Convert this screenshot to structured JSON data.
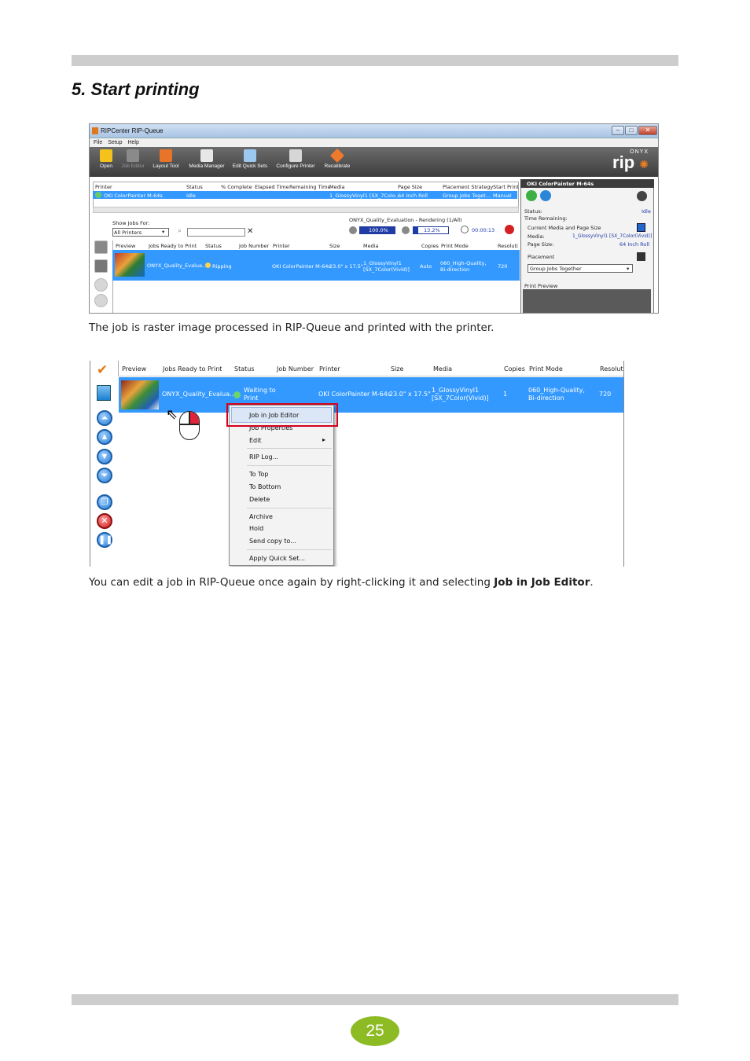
{
  "heading": "5. Start printing",
  "caption1": "The job is raster image processed in RIP-Queue and printed with the printer.",
  "caption2_pre": "You can edit a job in RIP-Queue once again by right-clicking it and selecting ",
  "caption2_bold": "Job in Job Editor",
  "caption2_post": ".",
  "page_number": "25",
  "screenshot1": {
    "window_title": "RIPCenter RIP-Queue",
    "menu": [
      "File",
      "Setup",
      "Help"
    ],
    "toolbar": [
      "Open",
      "Job Editor",
      "Layout Tool",
      "Media Manager",
      "Edit Quick Sets",
      "Configure Printer",
      "Recalibrate"
    ],
    "logo_brand": "ONYX",
    "logo_product": "rip",
    "printer_columns": [
      "Printer",
      "Status",
      "% Complete",
      "Elapsed Time",
      "Remaining Time",
      "Media",
      "Page Size",
      "Placement Strategy",
      "Start Print"
    ],
    "printer_row": {
      "printer": "OKI ColorPainter M-64s",
      "status": "Idle",
      "media": "1_GlossyVinyl1 [SX_7Colo...",
      "page_size": "64 Inch Roll",
      "placement": "Group Jobs Toget...",
      "start": "Manual"
    },
    "show_jobs_label": "Show Jobs For:",
    "show_jobs_value": "All Printers",
    "rendering_status": "ONYX_Quality_Evaluation - Rendering (1/All)",
    "progress1": "100.0%",
    "progress2": "13.2%",
    "timer": "00:00:13",
    "job_columns": [
      "Preview",
      "Jobs Ready to Print",
      "Status",
      "Job Number",
      "Printer",
      "Size",
      "Media",
      "Copies",
      "Print Mode",
      "Resoluti"
    ],
    "job_row": {
      "name": "ONYX_Quality_Evalua...",
      "status": "Ripping",
      "printer": "OKI ColorPainter M-64s",
      "size": "23.0\" x 17.5\"",
      "media_line1": "1_GlossyVinyl1",
      "media_line2": "[SX_7Color(Vivid)]",
      "copies": "Auto",
      "mode_line1": "060_High-Quality,",
      "mode_line2": "Bi-direction",
      "resolution": "720"
    },
    "side_panel": {
      "title": "OKI ColorPainter M-64s",
      "status_label": "Status:",
      "status_value": "Idle",
      "time_remaining_label": "Time Remaining:",
      "current_media_label": "Current Media and Page Size",
      "media_label": "Media:",
      "media_value": "1_GlossyVinyl1 [SX_7Color(Vivid)]",
      "page_size_label": "Page Size:",
      "page_size_value": "64 Inch Roll",
      "placement_label": "Placement",
      "placement_value": "Group Jobs Together",
      "preview_label": "Print Preview"
    }
  },
  "screenshot2": {
    "columns": [
      "Preview",
      "Jobs Ready to Print",
      "Status",
      "Job Number",
      "Printer",
      "Size",
      "Media",
      "Copies",
      "Print Mode",
      "Resoluti"
    ],
    "row": {
      "name": "ONYX_Quality_Evalua...",
      "status_line1": "Waiting to",
      "status_line2": "Print",
      "printer": "OKI ColorPainter M-64s",
      "size": "23.0\" x 17.5\"",
      "media_line1": "1_GlossyVinyl1",
      "media_line2": "[SX_7Color(Vivid)]",
      "copies": "1",
      "mode_line1": "060_High-Quality,",
      "mode_line2": "Bi-direction",
      "resolution": "720"
    },
    "context_menu": [
      "Job in Job Editor",
      "Job Properties",
      "Edit",
      "RIP Log...",
      "To Top",
      "To Bottom",
      "Delete",
      "Archive",
      "Hold",
      "Send copy to...",
      "Apply Quick Set..."
    ]
  },
  "colors": {
    "selection_blue": "#3399ff",
    "highlight_red": "#d4001e",
    "page_badge_green": "#8dbb24",
    "rule_gray": "#cdcdcd"
  }
}
